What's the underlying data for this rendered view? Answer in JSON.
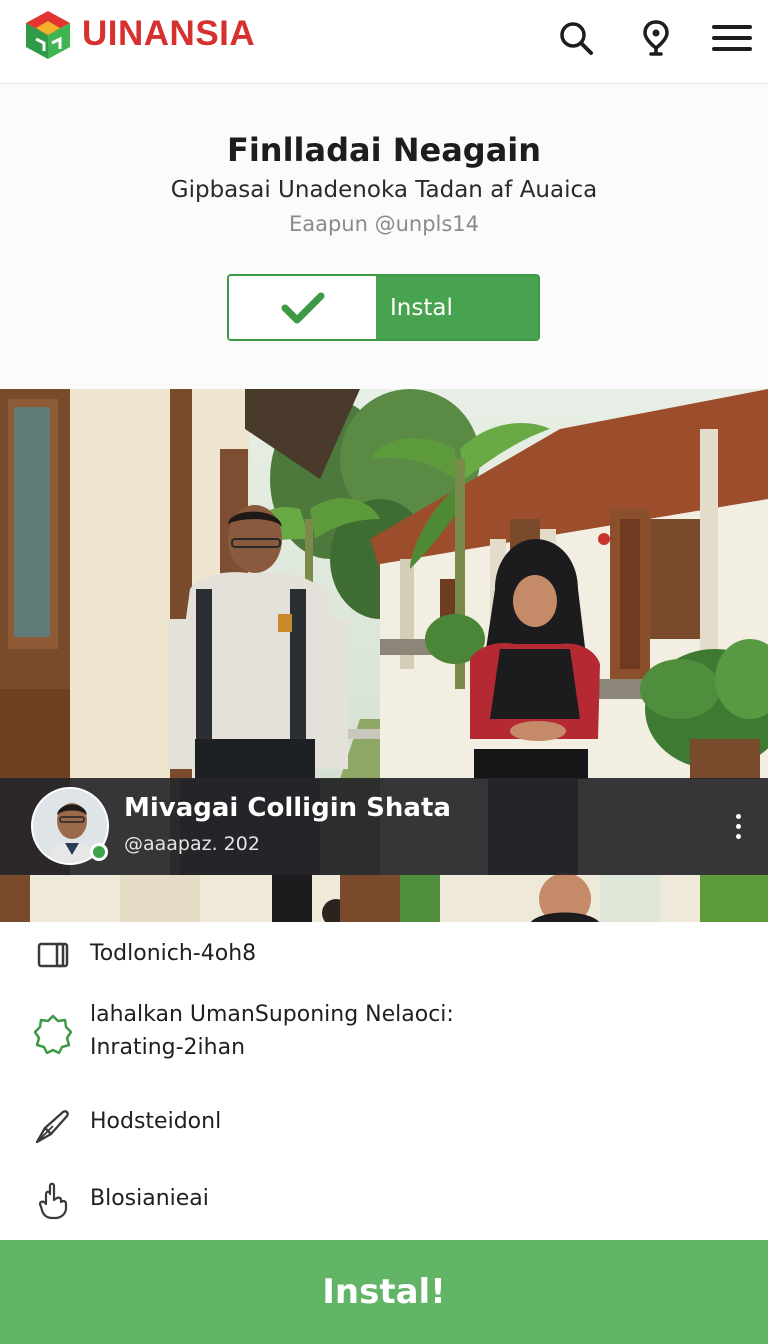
{
  "header": {
    "brand": "UINANSIA",
    "icons": [
      "logo-icon",
      "search-icon",
      "location-pin-icon",
      "hamburger-menu-icon"
    ],
    "brand_color": "#d6302f"
  },
  "app": {
    "title": "Finlladai Neagain",
    "subtitle": "Gipbasai Unadenoka Tadan af Auaica",
    "handle": "Eaapun @unpls14",
    "install_label": "Instal"
  },
  "profile": {
    "name": "Mivagai Colligin Shata",
    "handle": "@aaapaz. 202"
  },
  "details": [
    {
      "icon": "phone-device-icon",
      "text": "Todlonich-4oh8"
    },
    {
      "icon": "badge-icon",
      "text": "lahalkan UmanSuponing Nelaoci:",
      "text2": "Inrating-2ihan"
    },
    {
      "icon": "pen-icon",
      "text": "Hodsteidonl"
    },
    {
      "icon": "hand-pointer-icon",
      "text": "Blosianieai"
    }
  ],
  "cta": {
    "label": "Instal!"
  },
  "colors": {
    "accent_green": "#47a34f",
    "cta_green": "#62b466",
    "overlay": "#26262a"
  }
}
